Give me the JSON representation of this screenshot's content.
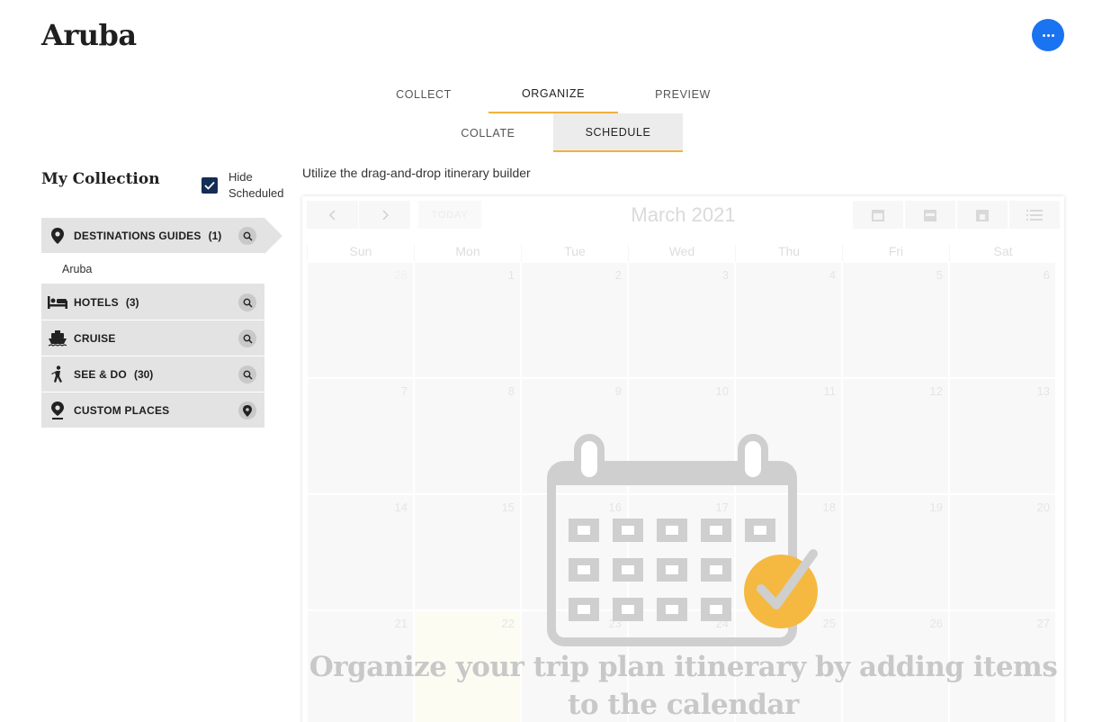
{
  "page": {
    "title": "Aruba",
    "more_icon": "more-horiz-icon",
    "accent_color": "#f0b23c",
    "brand_blue": "#1a73f0"
  },
  "tabs": [
    {
      "label": "COLLECT",
      "active": false
    },
    {
      "label": "ORGANIZE",
      "active": true
    },
    {
      "label": "PREVIEW",
      "active": false
    }
  ],
  "subtabs": [
    {
      "label": "COLLATE",
      "active": false
    },
    {
      "label": "SCHEDULE",
      "active": true
    }
  ],
  "collection": {
    "title": "My Collection",
    "hide_scheduled": {
      "label_line1": "Hide",
      "label_line2": "Scheduled",
      "checked": true
    },
    "categories": [
      {
        "label": "DESTINATIONS GUIDES",
        "count": "(1)",
        "icon": "map-pin-icon",
        "action_icon": "search-icon",
        "expanded": true,
        "items": [
          "Aruba"
        ]
      },
      {
        "label": "HOTELS",
        "count": "(3)",
        "icon": "bed-icon",
        "action_icon": "search-icon"
      },
      {
        "label": "CRUISE",
        "count": "",
        "icon": "ship-icon",
        "action_icon": "search-icon"
      },
      {
        "label": "SEE & DO",
        "count": "(30)",
        "icon": "walking-person-icon",
        "action_icon": "search-icon"
      },
      {
        "label": "CUSTOM PLACES",
        "count": "",
        "icon": "map-pin-icon",
        "action_icon": "add-location-icon"
      }
    ]
  },
  "schedule": {
    "hint": "Utilize the drag-and-drop itinerary builder",
    "calendar": {
      "month": "March 2021",
      "today_label": "TODAY",
      "prev_icon": "chevron-left-icon",
      "next_icon": "chevron-right-icon",
      "view_icons": [
        "month-view-icon",
        "week-view-icon",
        "day-view-icon",
        "list-view-icon"
      ],
      "weekdays": [
        "Sun",
        "Mon",
        "Tue",
        "Wed",
        "Thu",
        "Fri",
        "Sat"
      ],
      "weeks": [
        [
          "28",
          "1",
          "2",
          "3",
          "4",
          "5",
          "6"
        ],
        [
          "7",
          "8",
          "9",
          "10",
          "11",
          "12",
          "13"
        ],
        [
          "14",
          "15",
          "16",
          "17",
          "18",
          "19",
          "20"
        ],
        [
          "21",
          "22",
          "23",
          "24",
          "25",
          "26",
          "27"
        ]
      ],
      "highlighted_day": "22"
    },
    "empty_state": {
      "icon": "calendar-check-icon",
      "message": "Organize your trip plan itinerary by adding items to the calendar"
    }
  }
}
